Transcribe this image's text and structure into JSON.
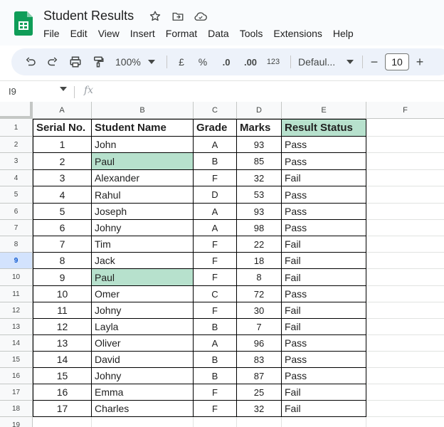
{
  "app": {
    "doc_title": "Student Results",
    "menu": [
      "File",
      "Edit",
      "View",
      "Insert",
      "Format",
      "Data",
      "Tools",
      "Extensions",
      "Help"
    ]
  },
  "toolbar": {
    "zoom": "100%",
    "currency": "£",
    "percent": "%",
    "decrease_decimal": ".0",
    "increase_decimal": ".00",
    "number_format": "123",
    "font": "Defaul...",
    "font_size": "10",
    "minus": "−",
    "plus": "+"
  },
  "formula_bar": {
    "cell_ref": "I9",
    "fx": "fx"
  },
  "columns": [
    "A",
    "B",
    "C",
    "D",
    "E",
    "F"
  ],
  "row_numbers": [
    "1",
    "2",
    "3",
    "4",
    "5",
    "6",
    "7",
    "8",
    "9",
    "10",
    "11",
    "12",
    "13",
    "14",
    "15",
    "16",
    "17",
    "18",
    "19"
  ],
  "selected_row": "9",
  "table": {
    "headers": [
      "Serial No.",
      "Student Name",
      "Grade",
      "Marks",
      "Result Status"
    ],
    "rows": [
      [
        "1",
        "John",
        "A",
        "93",
        "Pass"
      ],
      [
        "2",
        "Paul",
        "B",
        "85",
        "Pass"
      ],
      [
        "3",
        "Alexander",
        "F",
        "32",
        "Fail"
      ],
      [
        "4",
        "Rahul",
        "D",
        "53",
        "Pass"
      ],
      [
        "5",
        "Joseph",
        "A",
        "93",
        "Pass"
      ],
      [
        "6",
        "Johny",
        "A",
        "98",
        "Pass"
      ],
      [
        "7",
        "Tim",
        "F",
        "22",
        "Fail"
      ],
      [
        "8",
        "Jack",
        "F",
        "18",
        "Fail"
      ],
      [
        "9",
        "Paul",
        "F",
        "8",
        "Fail"
      ],
      [
        "10",
        "Omer",
        "C",
        "72",
        "Pass"
      ],
      [
        "11",
        "Johny",
        "F",
        "30",
        "Fail"
      ],
      [
        "12",
        "Layla",
        "B",
        "7",
        "Fail"
      ],
      [
        "13",
        "Oliver",
        "A",
        "96",
        "Pass"
      ],
      [
        "14",
        "David",
        "B",
        "83",
        "Pass"
      ],
      [
        "15",
        "Johny",
        "B",
        "87",
        "Pass"
      ],
      [
        "16",
        "Emma",
        "F",
        "25",
        "Fail"
      ],
      [
        "17",
        "Charles",
        "F",
        "32",
        "Fail"
      ]
    ],
    "highlighted_name_rows": [
      1,
      8
    ]
  },
  "colors": {
    "highlight": "#b7e1cd",
    "sheets_green": "#0f9d58",
    "toolbar_bg": "#edf2fa"
  }
}
